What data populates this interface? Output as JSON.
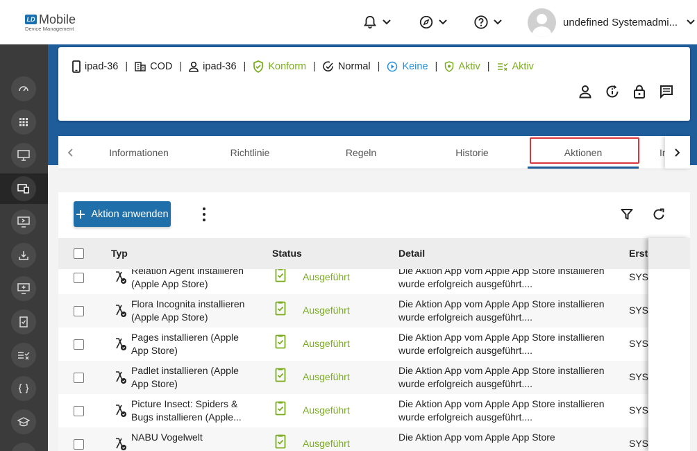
{
  "header": {
    "logo_text": "Mobile",
    "logo_badge": "LD",
    "logo_subtitle": "Device Management",
    "username": "undefined Systemadmi..."
  },
  "device": {
    "name": "ipad-36",
    "org": "COD",
    "user": "ipad-36",
    "compliance": "Konform",
    "state": "Normal",
    "mode": "Keine",
    "protection": "Aktiv",
    "policy": "Aktiv"
  },
  "tabs": {
    "items": [
      "Informationen",
      "Richtlinie",
      "Regeln",
      "Historie",
      "Aktionen",
      "In"
    ],
    "active": "Aktionen"
  },
  "toolbar": {
    "apply_action_label": "Aktion anwenden"
  },
  "table": {
    "headers": {
      "typ": "Typ",
      "status": "Status",
      "detail": "Detail",
      "erstellt": "Erste"
    },
    "rows": [
      {
        "typ": "Relation Agent installieren (Apple App Store)",
        "status": "Ausgeführt",
        "detail": "Die Aktion App vom Apple App Store installieren wurde erfolgreich ausgeführt....",
        "erstellt": "SYST"
      },
      {
        "typ": "Flora Incognita installieren (Apple App Store)",
        "status": "Ausgeführt",
        "detail": "Die Aktion App vom Apple App Store installieren wurde erfolgreich ausgeführt....",
        "erstellt": "SYST"
      },
      {
        "typ": "Pages installieren (Apple App Store)",
        "status": "Ausgeführt",
        "detail": "Die Aktion App vom Apple App Store installieren wurde erfolgreich ausgeführt....",
        "erstellt": "SYST"
      },
      {
        "typ": "Padlet installieren (Apple App Store)",
        "status": "Ausgeführt",
        "detail": "Die Aktion App vom Apple App Store installieren wurde erfolgreich ausgeführt....",
        "erstellt": "SYST"
      },
      {
        "typ": "Picture Insect: Spiders & Bugs installieren (Apple...",
        "status": "Ausgeführt",
        "detail": "Die Aktion App vom Apple App Store installieren wurde erfolgreich ausgeführt....",
        "erstellt": "SYST"
      },
      {
        "typ": "NABU Vogelwelt",
        "status": "Ausgeführt",
        "detail": "Die Aktion App vom Apple App Store",
        "erstellt": "SYST"
      }
    ]
  },
  "colors": {
    "brand_blue": "#1f5c9a",
    "primary_button": "#1f6fab",
    "success_green": "#7aad1e",
    "info_blue": "#2a8dd8",
    "highlight_red": "#d9363e",
    "sidebar_bg": "#3b3b3b"
  },
  "icons": {
    "header": [
      "bell-icon",
      "compass-icon",
      "help-icon"
    ],
    "sidebar": [
      "dashboard-icon",
      "apps-grid-icon",
      "device-monitor-icon",
      "devices-icon",
      "remote-screen-icon",
      "download-icon",
      "monitor-add-icon",
      "checklist-icon",
      "compliance-icon",
      "code-braces-icon",
      "education-icon"
    ]
  }
}
